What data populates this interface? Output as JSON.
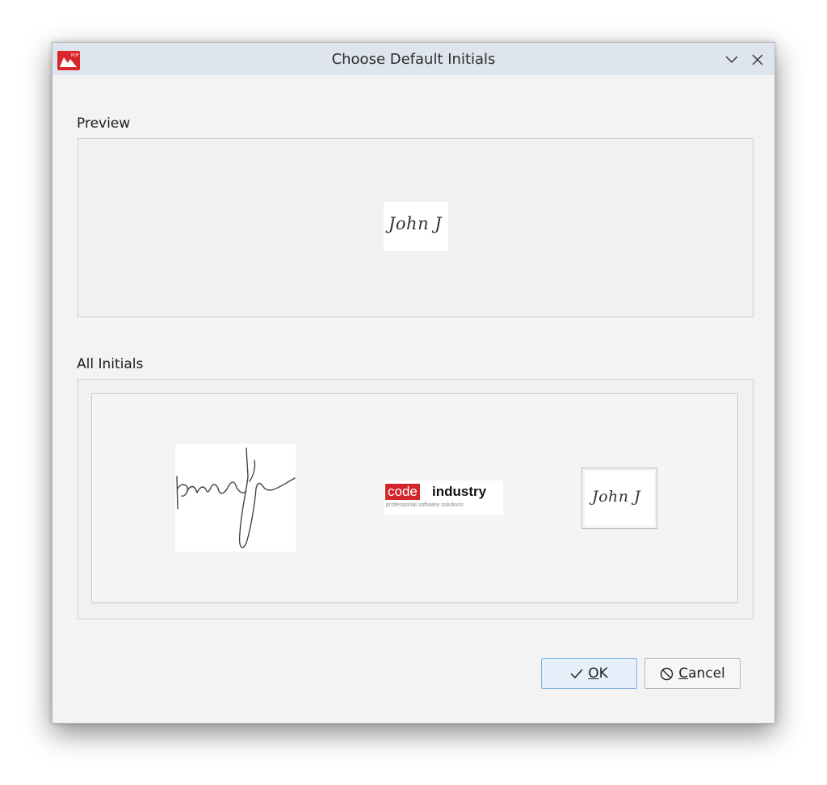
{
  "window": {
    "title": "Choose Default Initials",
    "app_icon": "pdf-app-icon",
    "app_icon_badge": "PDF",
    "minimize_icon": "chevron-down-icon",
    "close_icon": "close-icon"
  },
  "preview": {
    "label": "Preview",
    "initials_text": "John J"
  },
  "all_initials": {
    "label": "All Initials",
    "items": [
      {
        "kind": "handwritten-signature",
        "icon": "signature-image"
      },
      {
        "kind": "logo",
        "logo_code": "code",
        "logo_industry": "industry",
        "logo_tagline": "professional software solutions"
      },
      {
        "kind": "text",
        "initials_text": "John J",
        "selected": true
      }
    ]
  },
  "buttons": {
    "ok_prefix": "",
    "ok_mnemonic": "O",
    "ok_rest": "K",
    "ok_icon": "checkmark-icon",
    "cancel_mnemonic": "C",
    "cancel_rest": "ancel",
    "cancel_icon": "cancel-circle-icon"
  },
  "colors": {
    "titlebar": "#dfe5ee",
    "dialog_bg": "#f3f3f3",
    "ok_button_bg": "#e6f0fa",
    "logo_red": "#d3262c"
  }
}
